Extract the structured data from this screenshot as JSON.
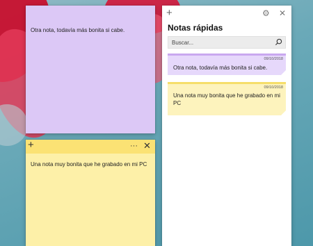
{
  "notes": {
    "purple": {
      "text": "Otra nota, todavía más bonita si cabe.",
      "color": "#dcc8f6"
    },
    "yellow": {
      "text": "Una nota muy bonita que he grabado en mi PC",
      "color": "#fdf0a8",
      "titlebar": {
        "new_icon": "+",
        "menu_icon": "···",
        "close_icon": "✕"
      }
    }
  },
  "panel": {
    "title": "Notas rápidas",
    "new_icon": "+",
    "settings_icon": "⚙",
    "close_icon": "✕",
    "search": {
      "placeholder": "Buscar..."
    },
    "items": [
      {
        "date": "09/10/2018",
        "text": "Otra nota, todavía más bonita si cabe.",
        "color": "#e6d8fb"
      },
      {
        "date": "09/10/2018",
        "text": "Una nota muy bonita que he grabado en mi PC",
        "color": "#fdf3bd"
      }
    ]
  }
}
